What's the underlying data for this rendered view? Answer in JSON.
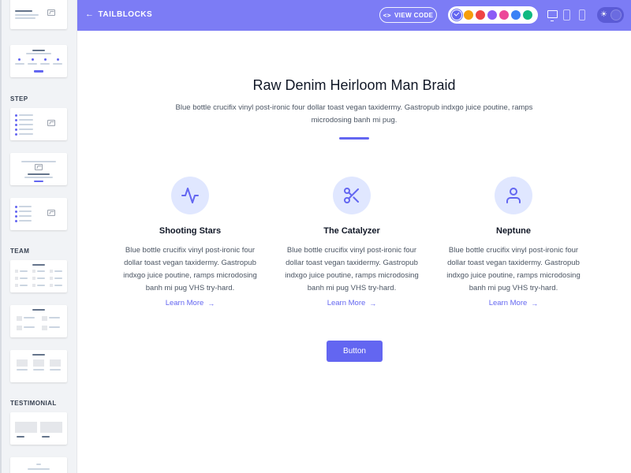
{
  "topbar": {
    "back_label": "TAILBLOCKS",
    "view_code_label": "VIEW CODE",
    "palette": [
      {
        "name": "indigo",
        "color": "#6366f1",
        "selected": true
      },
      {
        "name": "yellow",
        "color": "#f59e0b",
        "selected": false
      },
      {
        "name": "red",
        "color": "#ef4444",
        "selected": false
      },
      {
        "name": "purple",
        "color": "#8b5cf6",
        "selected": false
      },
      {
        "name": "pink",
        "color": "#ec4899",
        "selected": false
      },
      {
        "name": "blue",
        "color": "#3b82f6",
        "selected": false
      },
      {
        "name": "green",
        "color": "#10b981",
        "selected": false
      }
    ],
    "devices": [
      "desktop-icon",
      "tablet-icon",
      "phone-icon"
    ],
    "theme_toggle_icon": "sun-icon"
  },
  "sidebar": {
    "sections": [
      "STEP",
      "TEAM",
      "TESTIMONIAL"
    ]
  },
  "main": {
    "title": "Raw Denim Heirloom Man Braid",
    "subtitle": "Blue bottle crucifix vinyl post-ironic four dollar toast vegan taxidermy. Gastropub indxgo juice poutine, ramps microdosing banh mi pug.",
    "features": [
      {
        "icon": "activity-icon",
        "title": "Shooting Stars",
        "text": "Blue bottle crucifix vinyl post-ironic four dollar toast vegan taxidermy. Gastropub indxgo juice poutine, ramps microdosing banh mi pug VHS try-hard.",
        "link": "Learn More"
      },
      {
        "icon": "scissors-icon",
        "title": "The Catalyzer",
        "text": "Blue bottle crucifix vinyl post-ironic four dollar toast vegan taxidermy. Gastropub indxgo juice poutine, ramps microdosing banh mi pug VHS try-hard.",
        "link": "Learn More"
      },
      {
        "icon": "user-icon",
        "title": "Neptune",
        "text": "Blue bottle crucifix vinyl post-ironic four dollar toast vegan taxidermy. Gastropub indxgo juice poutine, ramps microdosing banh mi pug VHS try-hard.",
        "link": "Learn More"
      }
    ],
    "button_label": "Button"
  },
  "colors": {
    "accent": "#6366f1",
    "topbar": "#7c7cf5",
    "icon_bg": "#e0e7ff"
  }
}
